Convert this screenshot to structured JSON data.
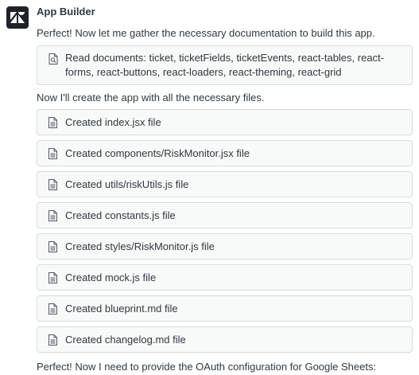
{
  "assistant": {
    "name": "App Builder",
    "avatar_icon": "zendesk-logo-icon",
    "avatar_bg": "#1f2329"
  },
  "messages": {
    "intro": "Perfect! Now let me gather the necessary documentation to build this app.",
    "read_docs": "Read documents: ticket, ticketFields, ticketEvents, react-tables, react-forms, react-buttons, react-loaders, react-theming, react-grid",
    "create_intro": "Now I'll create the app with all the necessary files.",
    "outro": "Perfect! Now I need to provide the OAuth configuration for Google Sheets:"
  },
  "files": [
    {
      "label": "Created index.jsx file",
      "icon": "file-icon"
    },
    {
      "label": "Created components/RiskMonitor.jsx file",
      "icon": "file-icon"
    },
    {
      "label": "Created utils/riskUtils.js file",
      "icon": "file-icon"
    },
    {
      "label": "Created constants.js file",
      "icon": "file-icon"
    },
    {
      "label": "Created styles/RiskMonitor.js file",
      "icon": "file-icon"
    },
    {
      "label": "Created mock.js file",
      "icon": "file-icon"
    },
    {
      "label": "Created blueprint.md file",
      "icon": "file-icon"
    },
    {
      "label": "Created changelog.md file",
      "icon": "file-icon"
    }
  ],
  "colors": {
    "card_bg": "#f8f9f9",
    "card_border": "#d8dcde",
    "text": "#2f3941"
  }
}
